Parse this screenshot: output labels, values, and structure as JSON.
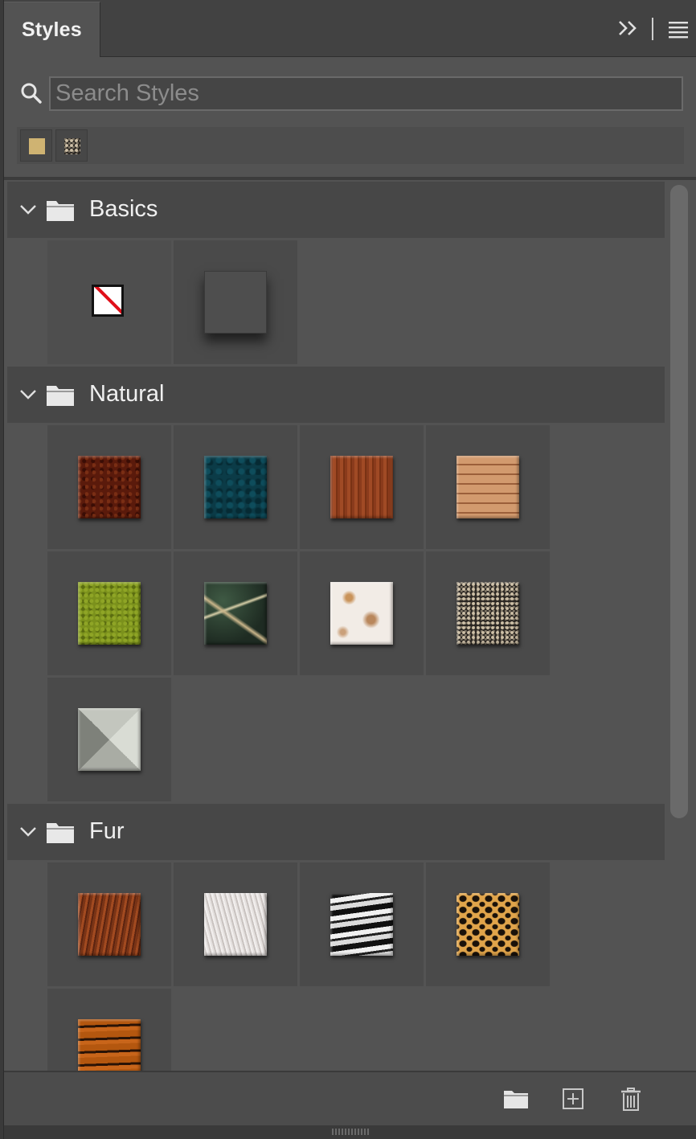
{
  "panel": {
    "tab_label": "Styles",
    "search_placeholder": "Search Styles",
    "search_value": ""
  },
  "recent_styles": [
    {
      "name": "gold-flat-style",
      "color": "#cfb372"
    },
    {
      "name": "dark-pebble-style",
      "color": "#5e5548"
    }
  ],
  "groups": [
    {
      "name": "Basics",
      "styles": [
        {
          "id": "none",
          "texture": "none"
        },
        {
          "id": "drop-shadow",
          "texture": "drop"
        }
      ]
    },
    {
      "name": "Natural",
      "styles": [
        {
          "id": "rust-earth",
          "texture": "t-rust"
        },
        {
          "id": "teal-water",
          "texture": "t-teal"
        },
        {
          "id": "red-wood",
          "texture": "t-wood"
        },
        {
          "id": "wood-planks",
          "texture": "t-planks"
        },
        {
          "id": "green-moss",
          "texture": "t-moss"
        },
        {
          "id": "dark-marble",
          "texture": "t-marble-dark"
        },
        {
          "id": "light-marble",
          "texture": "t-marble-light"
        },
        {
          "id": "pebbles",
          "texture": "t-pebble"
        },
        {
          "id": "stone-pyramid",
          "texture": "t-pyramid"
        }
      ]
    },
    {
      "name": "Fur",
      "styles": [
        {
          "id": "brown-fur",
          "texture": "t-fur-brown"
        },
        {
          "id": "white-fur",
          "texture": "t-fur-white"
        },
        {
          "id": "zebra-fur",
          "texture": "t-zebra"
        },
        {
          "id": "leopard-fur",
          "texture": "t-leopard"
        },
        {
          "id": "tiger-fur",
          "texture": "t-tiger"
        }
      ]
    }
  ],
  "footer": {
    "icons": [
      "new-group-folder-icon",
      "new-style-icon",
      "delete-trash-icon"
    ]
  }
}
